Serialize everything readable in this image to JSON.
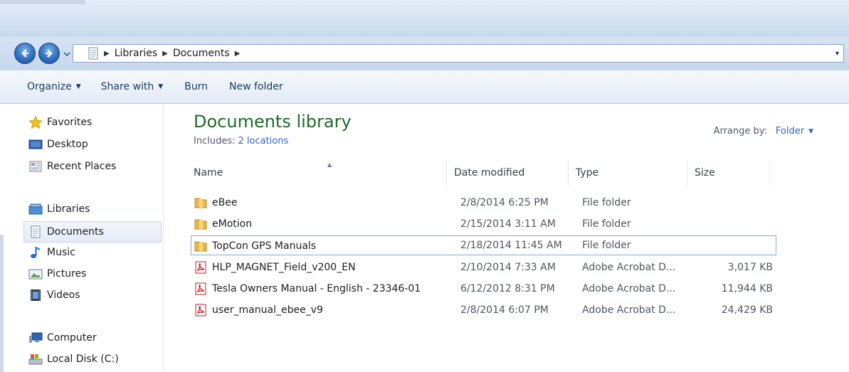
{
  "address": {
    "crumbs": [
      "Libraries",
      "Documents"
    ],
    "dropdown_glyph": "▾"
  },
  "toolbar": {
    "organize": "Organize",
    "share_with": "Share with",
    "burn": "Burn",
    "new_folder": "New folder"
  },
  "nav": {
    "favorites": {
      "label": "Favorites",
      "icon": "star-icon"
    },
    "desktop": {
      "label": "Desktop",
      "icon": "desktop-icon"
    },
    "recent_places": {
      "label": "Recent Places",
      "icon": "recent-places-icon"
    },
    "libraries": {
      "label": "Libraries",
      "icon": "libraries-icon"
    },
    "documents": {
      "label": "Documents",
      "icon": "document-icon"
    },
    "music": {
      "label": "Music",
      "icon": "music-icon"
    },
    "pictures": {
      "label": "Pictures",
      "icon": "pictures-icon"
    },
    "videos": {
      "label": "Videos",
      "icon": "videos-icon"
    },
    "computer": {
      "label": "Computer",
      "icon": "computer-icon"
    },
    "local_disk": {
      "label": "Local Disk (C:)",
      "icon": "drive-icon"
    }
  },
  "library": {
    "title": "Documents library",
    "includes_label": "Includes:",
    "includes_link": "2 locations",
    "arrange_label": "Arrange by:",
    "arrange_value": "Folder"
  },
  "columns": {
    "name": "Name",
    "date": "Date modified",
    "type": "Type",
    "size": "Size"
  },
  "files": [
    {
      "name": "eBee",
      "date": "2/8/2014 6:25 PM",
      "type": "File folder",
      "size": "",
      "icon": "folder-icon"
    },
    {
      "name": "eMotion",
      "date": "2/15/2014 3:11 AM",
      "type": "File folder",
      "size": "",
      "icon": "folder-icon"
    },
    {
      "name": "TopCon GPS Manuals",
      "date": "2/18/2014 11:45 AM",
      "type": "File folder",
      "size": "",
      "icon": "folder-icon"
    },
    {
      "name": "HLP_MAGNET_Field_v200_EN",
      "date": "2/10/2014 7:33 AM",
      "type": "Adobe Acrobat D...",
      "size": "3,017 KB",
      "icon": "pdf-icon"
    },
    {
      "name": "Tesla Owners Manual - English - 23346-01",
      "date": "6/12/2012 8:31 PM",
      "type": "Adobe Acrobat D...",
      "size": "11,944 KB",
      "icon": "pdf-icon"
    },
    {
      "name": "user_manual_ebee_v9",
      "date": "2/8/2014 6:07 PM",
      "type": "Adobe Acrobat D...",
      "size": "24,429 KB",
      "icon": "pdf-icon"
    }
  ],
  "colors": {
    "accent": "#2a66c8",
    "library_title": "#1d6a2a",
    "selection_border": "#84acd8"
  }
}
